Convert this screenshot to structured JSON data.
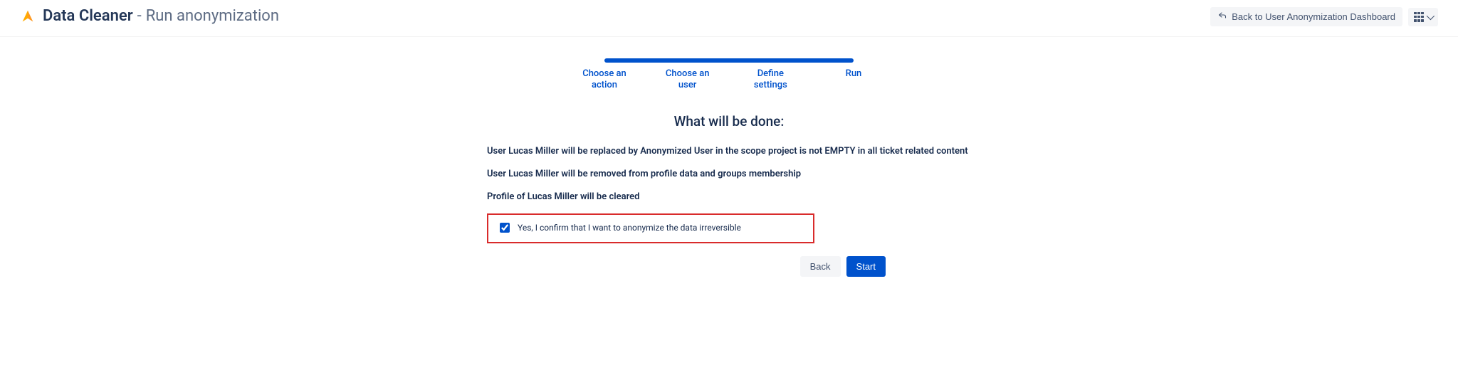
{
  "header": {
    "app_name": "Data Cleaner",
    "page_subtitle": "Run anonymization",
    "back_label": "Back to User Anonymization Dashboard"
  },
  "wizard": {
    "steps": [
      "Choose an\naction",
      "Choose an\nuser",
      "Define\nsettings",
      "Run"
    ],
    "active_index": 3
  },
  "summary": {
    "title": "What will be done:",
    "items": [
      "User Lucas Miller will be replaced by Anonymized User in the scope project is not EMPTY in all ticket related content",
      "User Lucas Miller will be removed from profile data and groups membership",
      "Profile of Lucas Miller will be cleared"
    ]
  },
  "confirm": {
    "label": "Yes, I confirm that I want to anonymize the data irreversible",
    "checked": true
  },
  "nav": {
    "back": "Back",
    "start": "Start"
  }
}
